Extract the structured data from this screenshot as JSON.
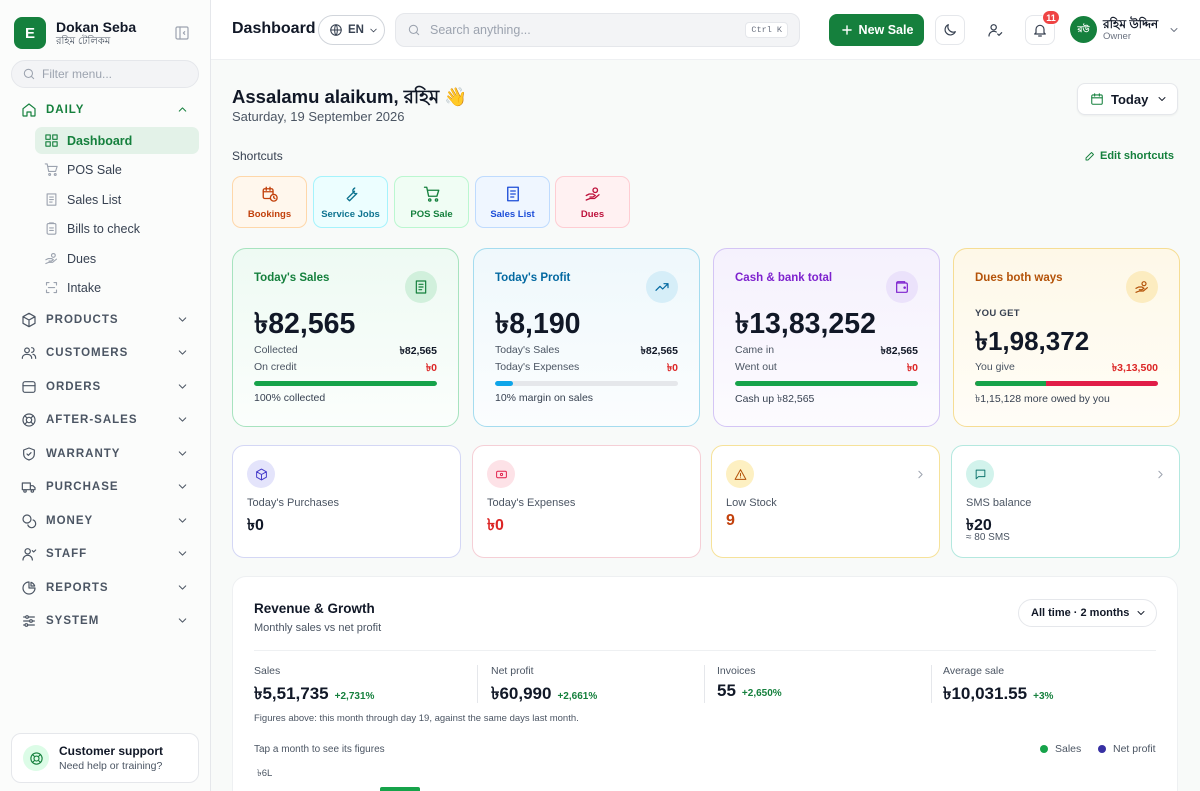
{
  "brand": {
    "initial": "E",
    "name": "Dokan Seba",
    "subtitle": "রহিম টেলিকম"
  },
  "sidebar": {
    "filter_placeholder": "Filter menu...",
    "sections": [
      {
        "label": "DAILY",
        "icon": "home-icon",
        "open": true
      },
      {
        "label": "PRODUCTS",
        "icon": "box-icon"
      },
      {
        "label": "CUSTOMERS",
        "icon": "users-icon"
      },
      {
        "label": "ORDERS",
        "icon": "orders-icon"
      },
      {
        "label": "AFTER-SALES",
        "icon": "lifebuoy-icon"
      },
      {
        "label": "WARRANTY",
        "icon": "shield-icon"
      },
      {
        "label": "PURCHASE",
        "icon": "truck-icon"
      },
      {
        "label": "MONEY",
        "icon": "coins-icon"
      },
      {
        "label": "STAFF",
        "icon": "user-icon"
      },
      {
        "label": "REPORTS",
        "icon": "pie-chart-icon"
      },
      {
        "label": "SYSTEM",
        "icon": "sliders-icon"
      }
    ],
    "daily_items": [
      {
        "label": "Dashboard",
        "icon": "grid-icon",
        "active": true
      },
      {
        "label": "POS Sale",
        "icon": "cart-icon"
      },
      {
        "label": "Sales List",
        "icon": "receipt-icon"
      },
      {
        "label": "Bills to check",
        "icon": "clipboard-icon"
      },
      {
        "label": "Dues",
        "icon": "hand-coins-icon"
      },
      {
        "label": "Intake",
        "icon": "scan-icon"
      }
    ],
    "support": {
      "title": "Customer support",
      "subtitle": "Need help or training?"
    }
  },
  "header": {
    "title": "Dashboard",
    "language": "EN",
    "search_placeholder": "Search anything...",
    "search_shortcut": "Ctrl K",
    "new_sale_label": "New Sale",
    "notification_count": "11",
    "user": {
      "initials": "রউ",
      "name": "রহিম উদ্দিন",
      "role": "Owner"
    }
  },
  "greeting": {
    "text": "Assalamu alaikum, রহিম 👋",
    "date": "Saturday, 19 September 2026"
  },
  "period_selector": "Today",
  "shortcuts": {
    "title": "Shortcuts",
    "edit_label": "Edit shortcuts",
    "items": [
      {
        "label": "Bookings",
        "icon": "calendar-clock-icon",
        "color": "#c2410c"
      },
      {
        "label": "Service Jobs",
        "icon": "wrench-icon",
        "color": "#0e7490"
      },
      {
        "label": "POS Sale",
        "icon": "cart-icon",
        "color": "#15803d"
      },
      {
        "label": "Sales List",
        "icon": "receipt-icon",
        "color": "#1d4ed8"
      },
      {
        "label": "Dues",
        "icon": "hand-coins-icon",
        "color": "#be123c"
      }
    ]
  },
  "stats": [
    {
      "title": "Today's Sales",
      "value": "৳82,565",
      "rows": [
        [
          "Collected",
          "৳82,565"
        ],
        [
          "On credit",
          "৳0"
        ]
      ],
      "progress": 1.0,
      "footer": "100% collected",
      "accent": "#15803d"
    },
    {
      "title": "Today's Profit",
      "value": "৳8,190",
      "rows": [
        [
          "Today's Sales",
          "৳82,565"
        ],
        [
          "Today's Expenses",
          "৳0"
        ]
      ],
      "progress": 0.1,
      "footer": "10% margin on sales",
      "accent": "#0369a1"
    },
    {
      "title": "Cash & bank total",
      "value": "৳13,83,252",
      "rows": [
        [
          "Came in",
          "৳82,565"
        ],
        [
          "Went out",
          "৳0"
        ]
      ],
      "progress": 1.0,
      "footer": "Cash up ৳82,565",
      "accent": "#7e22ce"
    },
    {
      "title": "Dues both ways",
      "kicker": "YOU GET",
      "value": "৳1,98,372",
      "rows": [
        [
          "You give",
          "৳3,13,500"
        ]
      ],
      "progress": 0.39,
      "footer": "৳1,15,128 more owed by you",
      "accent": "#b45309"
    }
  ],
  "mini_cards": [
    {
      "title": "Today's Purchases",
      "value": "৳0",
      "icon": "package-icon"
    },
    {
      "title": "Today's Expenses",
      "value": "৳0",
      "icon": "banknote-icon"
    },
    {
      "title": "Low Stock",
      "value": "9",
      "icon": "alert-triangle-icon"
    },
    {
      "title": "SMS balance",
      "value": "৳20",
      "sub": "≈ 80 SMS",
      "icon": "message-icon"
    }
  ],
  "revenue": {
    "title": "Revenue & Growth",
    "subtitle": "Monthly sales vs net profit",
    "range": "All time · 2 months",
    "kpis": [
      {
        "label": "Sales",
        "value": "৳5,51,735",
        "delta": "+2,731%"
      },
      {
        "label": "Net profit",
        "value": "৳60,990",
        "delta": "+2,661%"
      },
      {
        "label": "Invoices",
        "value": "55",
        "delta": "+2,650%"
      },
      {
        "label": "Average sale",
        "value": "৳10,031.55",
        "delta": "+3%"
      }
    ],
    "note": "Figures above: this month through day 19, against the same days last month.",
    "hint": "Tap a month to see its figures",
    "legend": [
      {
        "name": "Sales",
        "color": "#16a34a"
      },
      {
        "name": "Net profit",
        "color": "#3730a3"
      }
    ],
    "y_tick_top": "৳6L"
  }
}
